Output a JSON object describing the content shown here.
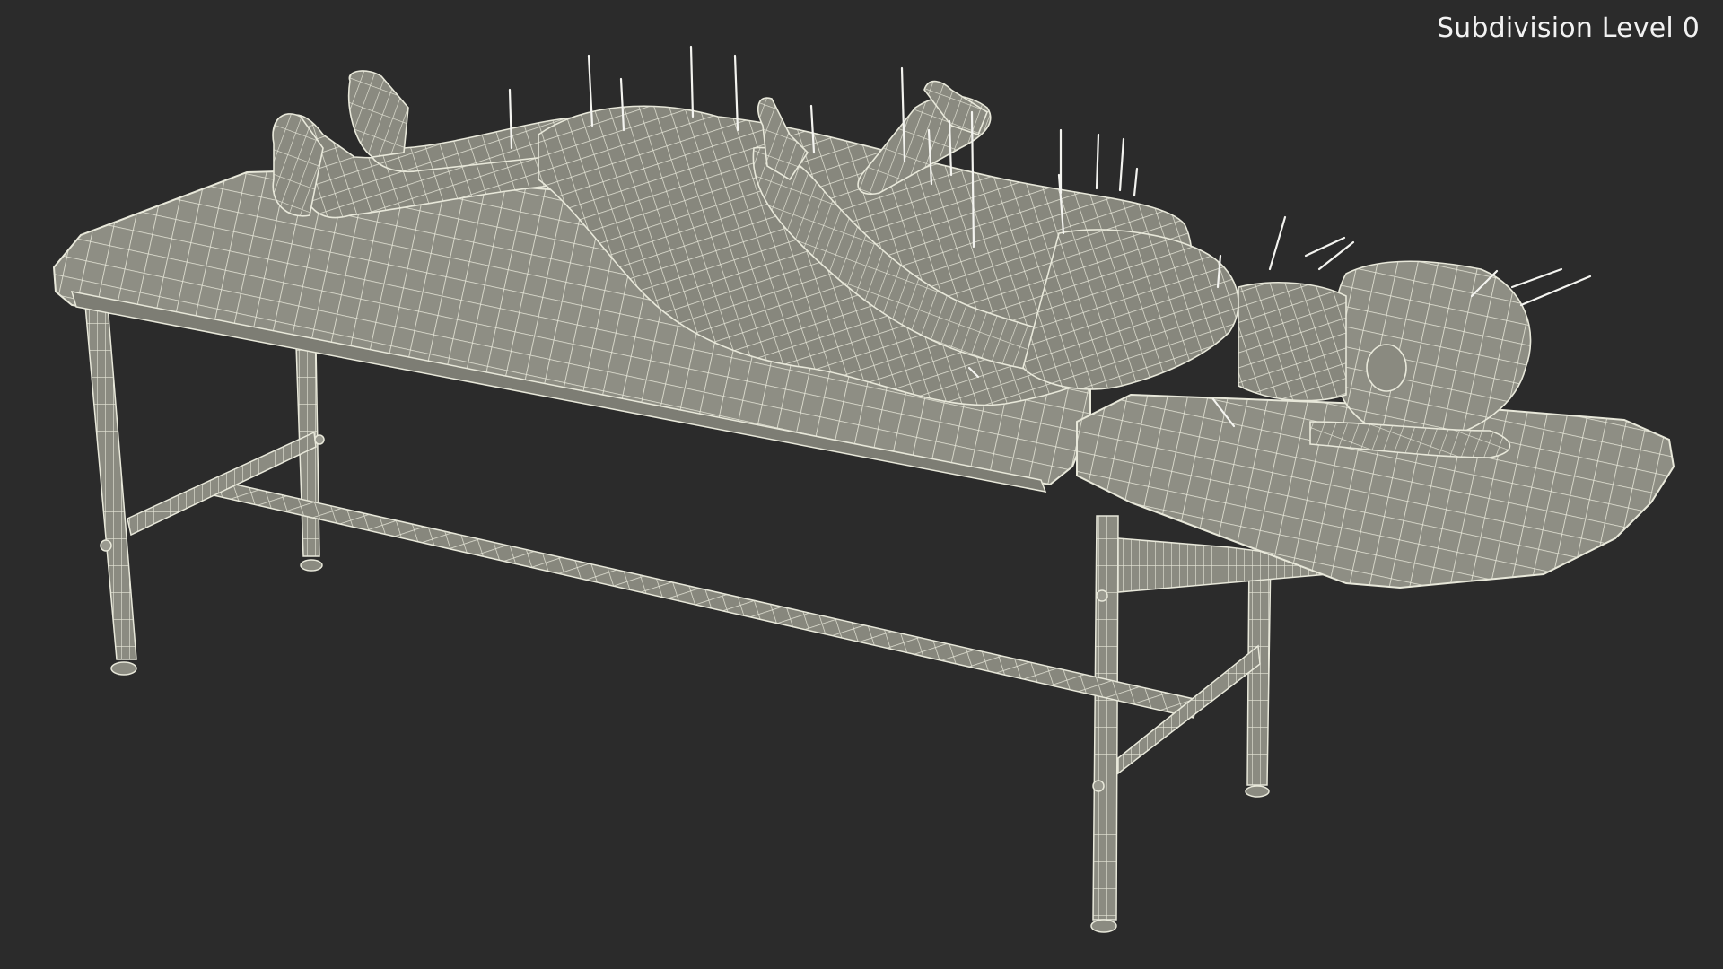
{
  "viewport": {
    "subdivision_label": "Subdivision Level 0"
  },
  "scene": {
    "model": "wireframe-human-on-treatment-table-with-acupuncture-needles",
    "background_color": "#2b2b2b",
    "mesh_fill_color": "#8e8e84",
    "wire_color": "#e8e8da",
    "needle_color": "#f4f4f0"
  }
}
